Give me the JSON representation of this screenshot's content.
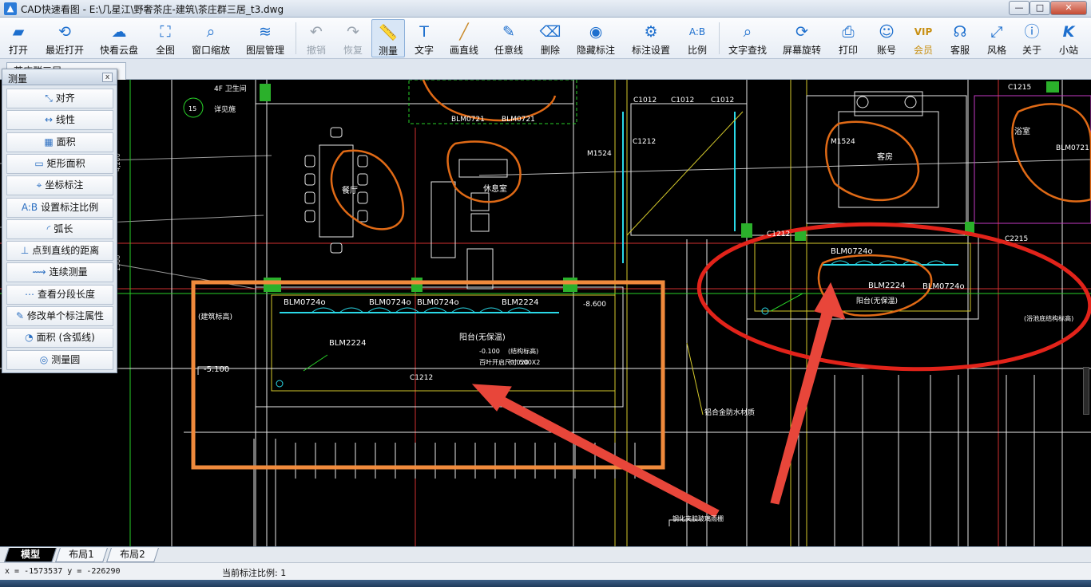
{
  "window": {
    "title": "CAD快速看图 - E:\\几星江\\野奢茶庄-建筑\\茶庄群三居_t3.dwg",
    "app_icon": "cad-app-icon",
    "min_label": "—",
    "max_label": "□",
    "close_label": "✕"
  },
  "toolbar": {
    "items": [
      {
        "label": "打开",
        "icon": "folder-open-icon"
      },
      {
        "label": "最近打开",
        "icon": "recent-clock-icon"
      },
      {
        "label": "快看云盘",
        "icon": "cloud-icon"
      },
      {
        "label": "全图",
        "icon": "fit-all-icon"
      },
      {
        "label": "窗口缩放",
        "icon": "window-zoom-icon"
      },
      {
        "label": "图层管理",
        "icon": "layers-icon"
      },
      {
        "label": "撤销",
        "icon": "undo-icon"
      },
      {
        "label": "恢复",
        "icon": "redo-icon"
      },
      {
        "label": "测量",
        "icon": "ruler-icon"
      },
      {
        "label": "文字",
        "icon": "text-icon"
      },
      {
        "label": "画直线",
        "icon": "line-icon"
      },
      {
        "label": "任意线",
        "icon": "freehand-icon"
      },
      {
        "label": "删除",
        "icon": "eraser-icon"
      },
      {
        "label": "隐藏标注",
        "icon": "eye-hidden-icon"
      },
      {
        "label": "标注设置",
        "icon": "annotation-settings-icon"
      },
      {
        "label": "比例",
        "icon": "scale-icon"
      },
      {
        "label": "文字查找",
        "icon": "text-search-icon"
      },
      {
        "label": "屏幕旋转",
        "icon": "rotate-screen-icon"
      },
      {
        "label": "打印",
        "icon": "printer-icon"
      },
      {
        "label": "账号",
        "icon": "user-icon"
      },
      {
        "label": "会员",
        "icon": "vip-badge-icon"
      },
      {
        "label": "客服",
        "icon": "headset-icon"
      },
      {
        "label": "风格",
        "icon": "style-icon"
      },
      {
        "label": "关于",
        "icon": "info-icon"
      },
      {
        "label": "小站",
        "icon": "site-k-icon"
      }
    ],
    "vip_color": "#c89014",
    "accent_color": "#1d6fce"
  },
  "file_tab": {
    "label": "茶庄群三居"
  },
  "measure_panel": {
    "title": "测量",
    "close_label": "x",
    "items": [
      {
        "label": "对齐",
        "icon": "align-measure-icon"
      },
      {
        "label": "线性",
        "icon": "linear-measure-icon"
      },
      {
        "label": "面积",
        "icon": "area-icon"
      },
      {
        "label": "矩形面积",
        "icon": "rect-area-icon"
      },
      {
        "label": "坐标标注",
        "icon": "coordinate-icon"
      },
      {
        "label": "设置标注比例",
        "icon": "set-scale-icon"
      },
      {
        "label": "弧长",
        "icon": "arc-length-icon"
      },
      {
        "label": "点到直线的距离",
        "icon": "point-line-distance-icon"
      },
      {
        "label": "连续测量",
        "icon": "continuous-measure-icon"
      },
      {
        "label": "查看分段长度",
        "icon": "segment-length-icon"
      },
      {
        "label": "修改单个标注属性",
        "icon": "edit-annotation-icon"
      },
      {
        "label": "面积 (含弧线)",
        "icon": "arc-area-icon"
      },
      {
        "label": "测量圆",
        "icon": "circle-measure-icon"
      }
    ]
  },
  "drawing": {
    "texts": [
      {
        "t": "4F 卫生间",
        "c": "#ffffff"
      },
      {
        "t": "详见施",
        "c": "#ffffff"
      },
      {
        "t": "15",
        "c": "#ffffff"
      },
      {
        "t": "BLM0721",
        "c": "#ffffff"
      },
      {
        "t": "BLM0721",
        "c": "#ffffff"
      },
      {
        "t": "餐厅",
        "c": "#ffffff"
      },
      {
        "t": "休息室",
        "c": "#ffffff"
      },
      {
        "t": "C1012",
        "c": "#ffffff"
      },
      {
        "t": "C1012",
        "c": "#ffffff"
      },
      {
        "t": "C1012",
        "c": "#ffffff"
      },
      {
        "t": "M1524",
        "c": "#ffffff"
      },
      {
        "t": "C1212",
        "c": "#ffffff"
      },
      {
        "t": "M1524",
        "c": "#ffffff"
      },
      {
        "t": "客房",
        "c": "#ffffff"
      },
      {
        "t": "C1215",
        "c": "#ffffff"
      },
      {
        "t": "浴室",
        "c": "#ffffff"
      },
      {
        "t": "BLM0721",
        "c": "#ffffff"
      },
      {
        "t": "C1212",
        "c": "#ffffff"
      },
      {
        "t": "C2215",
        "c": "#ffffff"
      },
      {
        "t": "BLM0724o",
        "c": "#ffffff"
      },
      {
        "t": "BLM2224",
        "c": "#ffffff"
      },
      {
        "t": "阳台(无保温)",
        "c": "#ffffff"
      },
      {
        "t": "BLM0724o",
        "c": "#ffffff"
      },
      {
        "t": "BLM0724o",
        "c": "#ffffff"
      },
      {
        "t": "BLM0724o",
        "c": "#ffffff"
      },
      {
        "t": "BLM0724o",
        "c": "#ffffff"
      },
      {
        "t": "BLM2224",
        "c": "#ffffff"
      },
      {
        "t": "BLM2224",
        "c": "#ffffff"
      },
      {
        "t": "阳台(无保温)",
        "c": "#ffffff"
      },
      {
        "t": "C1212",
        "c": "#ffffff"
      },
      {
        "t": "-8.600",
        "c": "#ffffff"
      },
      {
        "t": "-5.100",
        "c": "#ffffff"
      },
      {
        "t": "钢化夹胶玻璃雨棚",
        "c": "#ffffff"
      },
      {
        "t": "铝合金防水材质",
        "c": "#ffffff"
      },
      {
        "t": "(建筑标高)",
        "c": "#ffffff"
      },
      {
        "t": "(结构标高)",
        "c": "#ffffff"
      },
      {
        "t": "-0.020",
        "c": "#ffffff"
      },
      {
        "t": "-0.100",
        "c": "#ffffff"
      },
      {
        "t": "百叶开启尺寸 500X2",
        "c": "#ffffff"
      },
      {
        "t": "(浴池底结构标高)",
        "c": "#ffffff"
      }
    ],
    "rect_highlight_color": "#f08a3c",
    "ellipse_highlight_color": "#e2231a",
    "arrow_color": "#e8463a",
    "sketch_color": "#e06a16"
  },
  "layout_tabs": [
    {
      "label": "模型",
      "selected": true
    },
    {
      "label": "布局1",
      "selected": false
    },
    {
      "label": "布局2",
      "selected": false
    }
  ],
  "status": {
    "coords": "x = -1573537  y = -226290",
    "scale": "当前标注比例: 1"
  }
}
